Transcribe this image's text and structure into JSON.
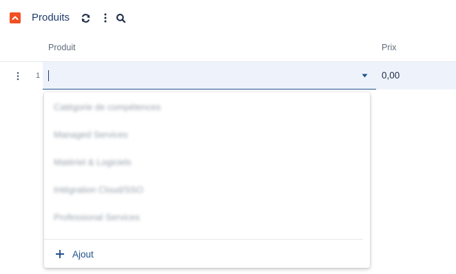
{
  "header": {
    "title": "Produits",
    "icons": {
      "collapse": "chevron-up-icon",
      "refresh": "refresh-icon",
      "more": "more-vertical-icon",
      "search": "search-icon"
    }
  },
  "table": {
    "columns": [
      "Produit",
      "Prix"
    ],
    "rows": [
      {
        "number": "1",
        "product": "",
        "price": "0,00"
      }
    ]
  },
  "dropdown": {
    "options": [
      "Catégorie de compétences",
      "Managed Services",
      "Matériel & Logiciels",
      "Intégration Cloud/SSO",
      "Professional Services"
    ],
    "add_label": "Ajout"
  },
  "colors": {
    "accent": "#f25022",
    "primary": "#1f4e8c",
    "row_highlight": "#eef3fb"
  }
}
